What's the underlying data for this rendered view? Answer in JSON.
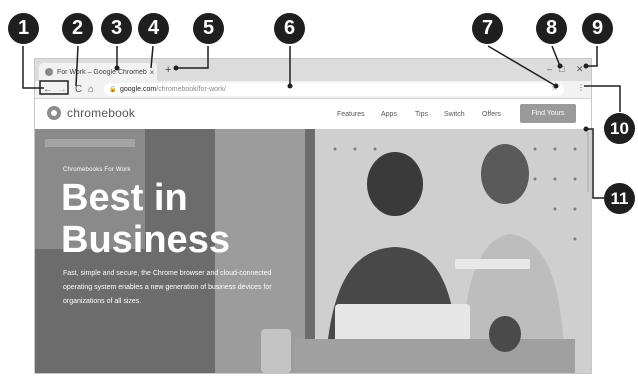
{
  "browser": {
    "tab": {
      "title": "For Work – Google Chromebooks",
      "close": "×"
    },
    "new_tab": "+",
    "window_controls": {
      "minimize": "–",
      "maximize": "□",
      "close": "✕"
    },
    "toolbar": {
      "back": "←",
      "forward": "→",
      "reload": "C",
      "home": "⌂",
      "lock": "🔒",
      "url_host": "google.com",
      "url_path": "/chromebook/for-work/",
      "star": "☆",
      "menu": "⋮"
    }
  },
  "site": {
    "logo_text": "chromebook",
    "nav": [
      "Features",
      "Apps",
      "Tips",
      "Switch",
      "Offers"
    ],
    "cta": "Find Yours"
  },
  "hero": {
    "eyebrow": "Chromebooks For Work",
    "headline_line1": "Best in",
    "headline_line2": "Business",
    "description": "Fast, simple and secure, the Chrome browser and cloud-connected operating system enables a new generation of business devices for organizations of all sizes."
  },
  "callouts": [
    "1",
    "2",
    "3",
    "4",
    "5",
    "6",
    "7",
    "8",
    "9",
    "10",
    "11"
  ],
  "colors": {
    "callout": "#1f1f1f",
    "cta": "#9a9a9a",
    "hero": "#6e6e6e"
  }
}
